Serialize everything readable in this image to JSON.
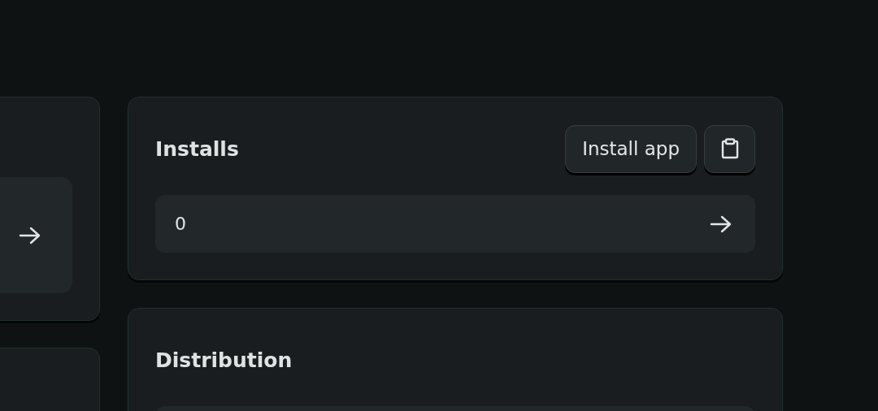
{
  "left_cards": [
    {
      "kind": "link"
    },
    {
      "kind": "empty"
    }
  ],
  "cards": [
    {
      "title": "Installs",
      "action": "Install app",
      "kind": "copy",
      "value": "0"
    },
    {
      "title": "Distribution",
      "kind": "plain"
    }
  ]
}
